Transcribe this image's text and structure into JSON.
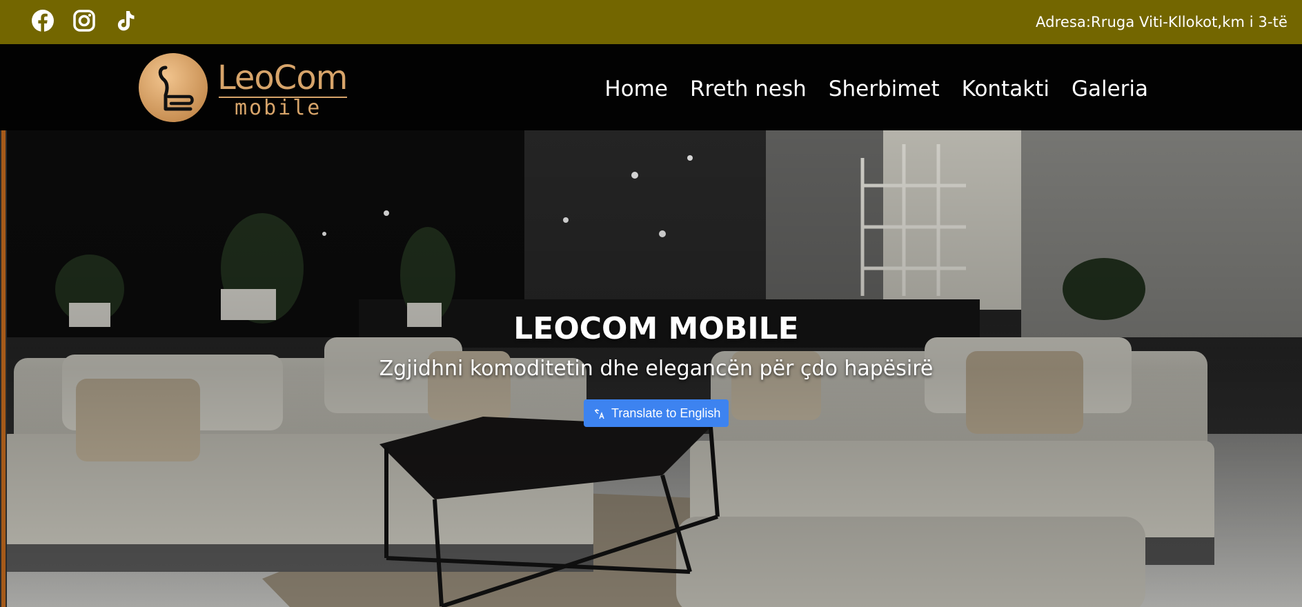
{
  "topbar": {
    "background": "#736600",
    "social": [
      {
        "name": "facebook",
        "icon": "facebook-icon"
      },
      {
        "name": "instagram",
        "icon": "instagram-icon"
      },
      {
        "name": "tiktok",
        "icon": "tiktok-icon"
      }
    ],
    "address": "Adresa:Rruga Viti-Kllokot,km i 3-të"
  },
  "navbar": {
    "logo": {
      "title": "LeoCom",
      "subtitle": "mobile",
      "icon": "leocom-logo-icon",
      "color": "#d7a46a"
    },
    "menu": [
      "Home",
      "Rreth nesh",
      "Sherbimet",
      "Kontakti",
      "Galeria"
    ]
  },
  "hero": {
    "title": "LEOCOM MOBILE",
    "subtitle": "Zgjidhni komoditetin dhe elegancën për çdo hapësirë",
    "translate_button": "Translate to English",
    "button_color": "#3d83f0",
    "image": "furniture-showroom-photo"
  }
}
